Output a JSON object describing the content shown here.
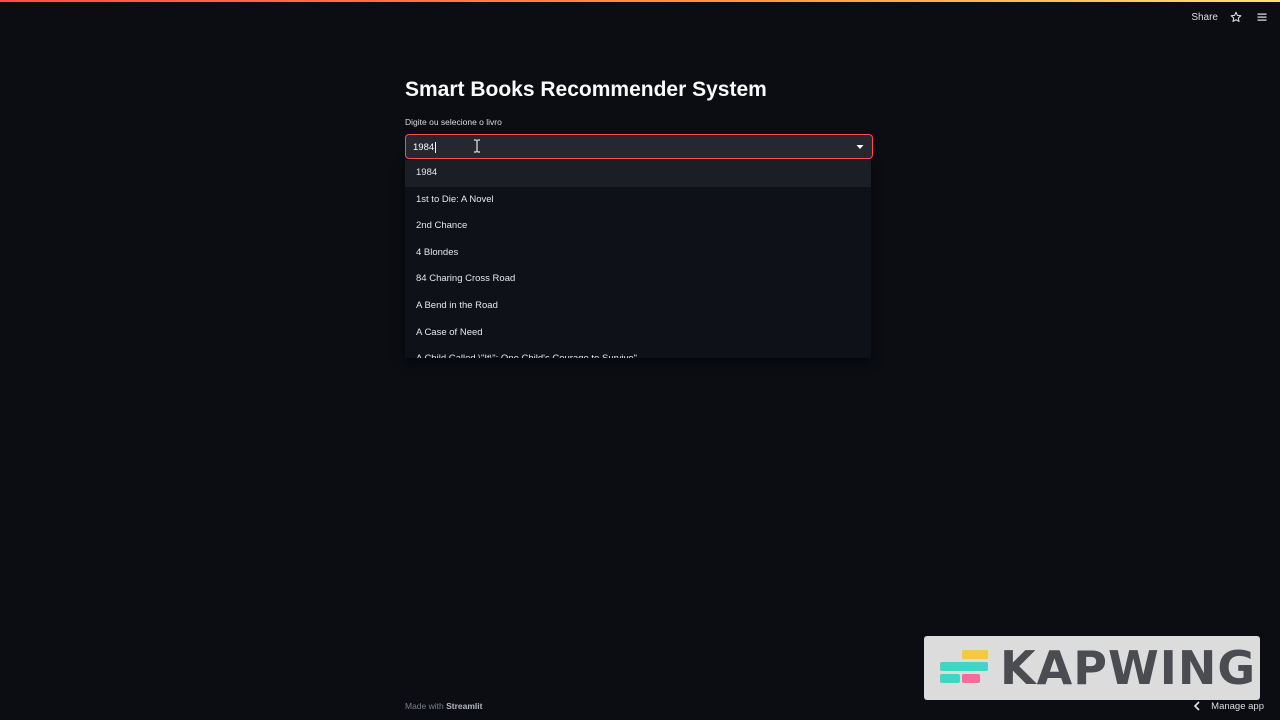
{
  "header": {
    "share_label": "Share",
    "star_icon": "star-icon",
    "menu_icon": "hamburger-menu-icon"
  },
  "main": {
    "title": "Smart Books Recommender System",
    "select_label": "Digite ou selecione o livro",
    "select_value": "1984",
    "options": [
      "1984",
      "1st to Die: A Novel",
      "2nd Chance",
      "4 Blondes",
      "84 Charing Cross Road",
      "A Bend in the Road",
      "A Case of Need",
      "A Child Called \\\"It\\\": One Child's Courage to Survive\""
    ],
    "active_option_index": 0
  },
  "footer": {
    "made_with": "Made with ",
    "brand": "Streamlit"
  },
  "watermark": {
    "text": "KAPWING"
  },
  "manage_app": {
    "label": "Manage app"
  },
  "colors": {
    "background": "#0b0d13",
    "accent": "#ff4b4b",
    "input_bg": "#262730"
  }
}
